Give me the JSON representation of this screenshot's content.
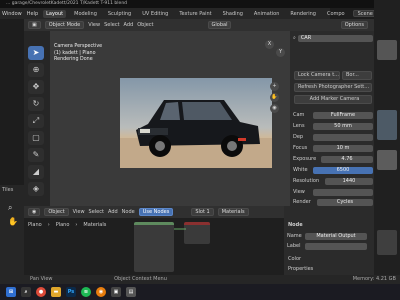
{
  "window": {
    "title": "... garage/ChevroletKadett/2021 T/Kadett T-911 blend"
  },
  "menu": {
    "items": [
      "Window",
      "Help"
    ],
    "tabs": [
      "Layout",
      "Modeling",
      "Sculpting",
      "UV Editing",
      "Texture Paint",
      "Shading",
      "Animation",
      "Rendering",
      "Compo"
    ],
    "active_tab": "Layout",
    "scene": "Scene"
  },
  "viewport_header": {
    "mode": "Object Mode",
    "menus": [
      "View",
      "Select",
      "Add",
      "Object"
    ],
    "transform": "Global",
    "options": "Options"
  },
  "viewport_info": {
    "line1": "Camera Perspective",
    "line2": "(1) kadett | Plano",
    "line3": "Rendering Done"
  },
  "outliner": {
    "search": "CAR"
  },
  "photographer": {
    "lock_camera": "Lock Camera t...",
    "border": "Bor...",
    "refresh": "Refresh Photographer Sett...",
    "add_marker": "Add Marker Camera",
    "cam_label": "Cam",
    "cam_value": "FullFrame",
    "lens_label": "Lens",
    "lens_value": "50 mm",
    "dep_label": "Dep",
    "focus_label": "Focus",
    "focus_value": "10 m",
    "exposure_label": "Exposure",
    "exposure_value": "4.76",
    "white_label": "White",
    "white_value": "6500",
    "resolution_label": "Resolution",
    "resolution_value": "1440",
    "view_label": "View",
    "render_label": "Render",
    "render_value": "Cycles"
  },
  "lower_left": {
    "label": "Tiles"
  },
  "node_header": {
    "type": "Object",
    "menus": [
      "View",
      "Select",
      "Add",
      "Node"
    ],
    "use_nodes": "Use Nodes",
    "slot": "Slot 1",
    "material": "Materials"
  },
  "node_breadcrumb": [
    "Plano",
    "Plano",
    "Materials"
  ],
  "node_props": {
    "section": "Node",
    "name_label": "Name",
    "name_value": "Material Output",
    "label_label": "Label",
    "color": "Color",
    "properties": "Properties"
  },
  "statusbar": {
    "left": "Pan View",
    "center": "Object Context Menu",
    "right": "Memory: 4.21 GB"
  },
  "taskbar": {
    "icons": [
      "windows",
      "search",
      "chrome",
      "explorer",
      "photoshop",
      "spotify",
      "blender",
      "app",
      "app2"
    ]
  },
  "colors": {
    "accent": "#4772b3",
    "active_tab": "#3c3c3c"
  }
}
